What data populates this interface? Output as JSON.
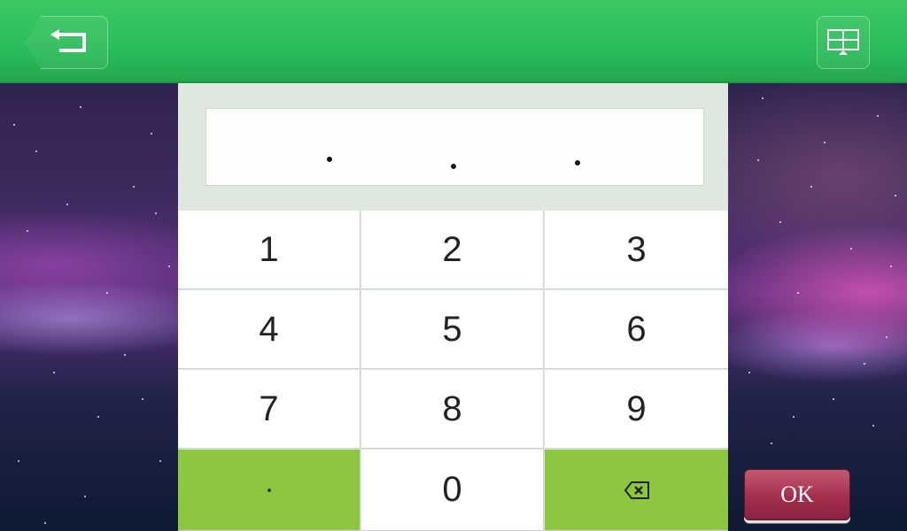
{
  "header": {
    "back_icon": "back-arrow-icon",
    "layout_icon": "display-grid-icon"
  },
  "ip_display": {
    "value": ". . ."
  },
  "keypad": {
    "keys": [
      "1",
      "2",
      "3",
      "4",
      "5",
      "6",
      "7",
      "8",
      "9",
      "·",
      "0",
      "backspace"
    ],
    "k1": "1",
    "k2": "2",
    "k3": "3",
    "k4": "4",
    "k5": "5",
    "k6": "6",
    "k7": "7",
    "k8": "8",
    "k9": "9",
    "k0": "0"
  },
  "ok_button": {
    "label": "OK"
  },
  "colors": {
    "header": "#2bbd5a",
    "key_accent": "#8dc63f",
    "ok": "#a32f4c"
  }
}
